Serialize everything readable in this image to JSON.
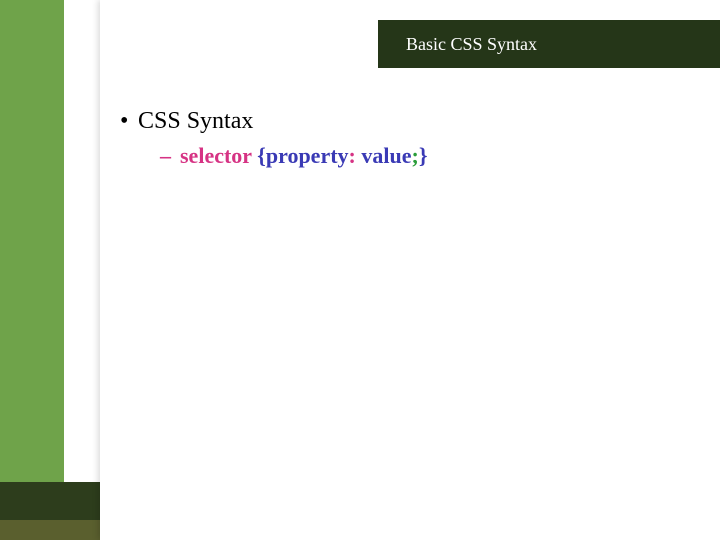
{
  "header": {
    "title": "Basic CSS Syntax"
  },
  "content": {
    "bullet1": "CSS Syntax",
    "syntax": {
      "selector": "selector ",
      "brace_open": "{",
      "property": "property",
      "colon": ": ",
      "value": "value",
      "semi": ";",
      "brace_close": "}"
    }
  }
}
